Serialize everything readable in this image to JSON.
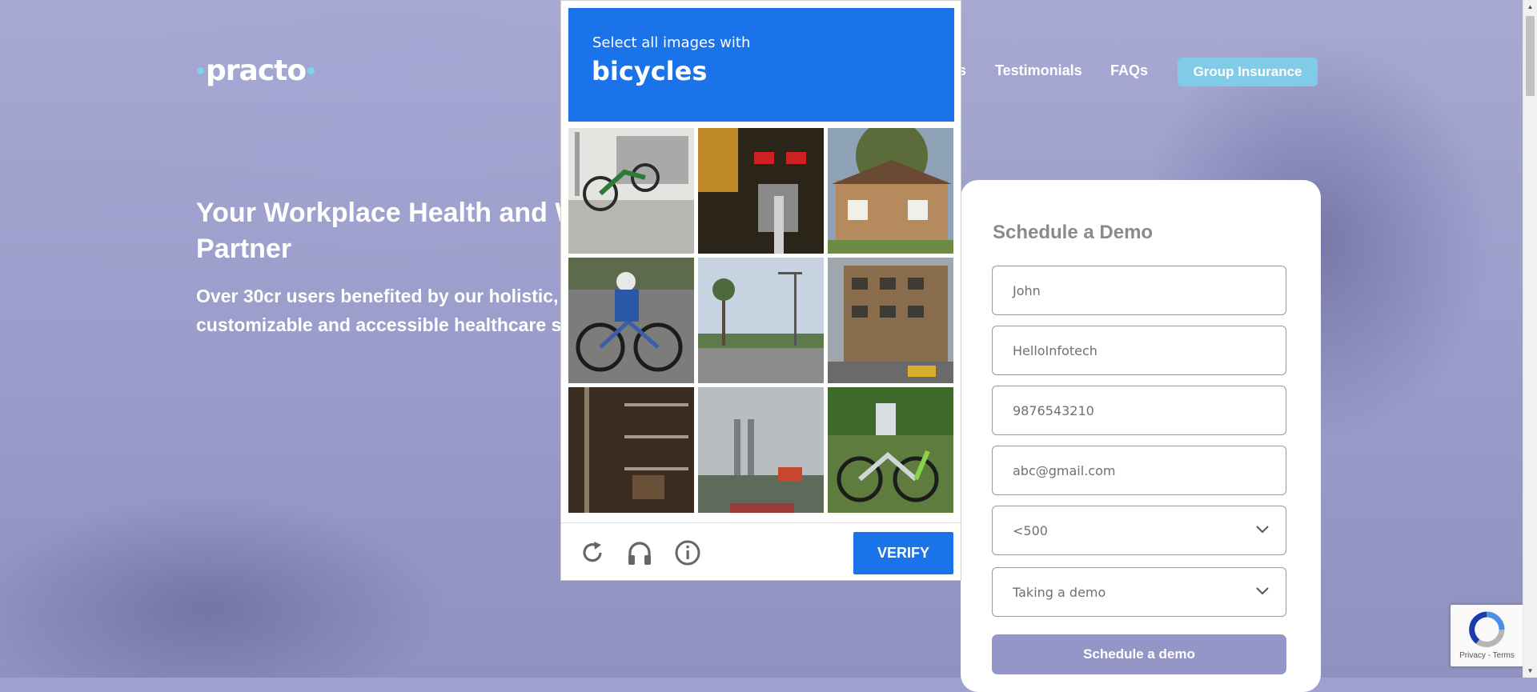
{
  "brand": {
    "logo_text": "practo",
    "accent": "#7fd1f0"
  },
  "nav": {
    "partial_item": "s",
    "testimonials": "Testimonials",
    "faqs": "FAQs",
    "cta": "Group Insurance"
  },
  "hero": {
    "headline_line1": "Your Workplace Health and W",
    "headline_line2": "Partner",
    "subline_line1": "Over 30cr users benefited by our holistic,",
    "subline_line2": "customizable and accessible healthcare s"
  },
  "form": {
    "title": "Schedule a Demo",
    "fields": [
      {
        "value": "John"
      },
      {
        "value": "HelloInfotech"
      },
      {
        "value": "9876543210"
      },
      {
        "value": "abc@gmail.com"
      }
    ],
    "selects": [
      {
        "value": "<500",
        "icon": "chevron-down-icon"
      },
      {
        "value": "Taking a demo",
        "icon": "chevron-down-icon"
      }
    ],
    "submit": "Schedule a demo",
    "submit_color": "#9496c8"
  },
  "captcha": {
    "instruction": "Select all images with",
    "target": "bicycles",
    "header_color": "#1a73e8",
    "tiles": [
      "bike-share-dock",
      "motorbike-closeup",
      "house-with-tree",
      "cyclist-on-road",
      "street-with-palms",
      "apartment-building",
      "storage-shelves",
      "industrial-chimney",
      "parked-bicycles"
    ],
    "footer_icons": [
      "reload-icon",
      "headphones-icon",
      "info-icon"
    ],
    "verify_label": "VERIFY"
  },
  "recaptcha_badge": {
    "links": "Privacy - Terms",
    "icon": "recaptcha-logo-icon"
  }
}
